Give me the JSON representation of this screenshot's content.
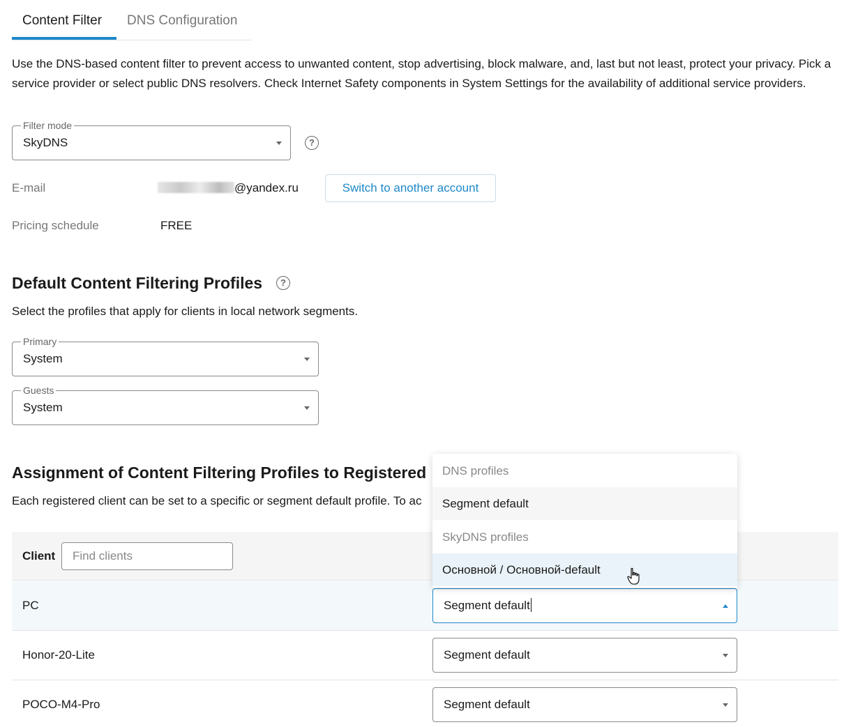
{
  "tabs": [
    {
      "label": "Content Filter",
      "active": true
    },
    {
      "label": "DNS Configuration",
      "active": false
    }
  ],
  "intro_text": "Use the DNS-based content filter to prevent access to unwanted content, stop advertising, block malware, and, last but not least, protect your privacy. Pick a service provider or select public DNS resolvers. Check Internet Safety components in System Settings for the availability of additional service providers.",
  "filter_mode": {
    "legend": "Filter mode",
    "value": "SkyDNS"
  },
  "email": {
    "label": "E-mail",
    "value": "@yandex.ru"
  },
  "switch_account_label": "Switch to another account",
  "pricing": {
    "label": "Pricing schedule",
    "value": "FREE"
  },
  "default_profiles": {
    "title": "Default Content Filtering Profiles",
    "description": "Select the profiles that apply for clients in local network segments.",
    "primary": {
      "legend": "Primary",
      "value": "System"
    },
    "guests": {
      "legend": "Guests",
      "value": "System"
    }
  },
  "assignment": {
    "title": "Assignment of Content Filtering Profiles to Registered",
    "description": "Each registered client can be set to a specific or segment default profile. To ac",
    "client_header": "Client",
    "search_placeholder": "Find clients"
  },
  "clients": [
    {
      "name": "PC",
      "profile": "Segment default"
    },
    {
      "name": "Honor-20-Lite",
      "profile": "Segment default"
    },
    {
      "name": "POCO-M4-Pro",
      "profile": "Segment default"
    }
  ],
  "dropdown": {
    "items": [
      {
        "label": "DNS profiles",
        "type": "group"
      },
      {
        "label": "Segment default",
        "type": "option"
      },
      {
        "label": "SkyDNS profiles",
        "type": "group"
      },
      {
        "label": "Основной / Основной-default",
        "type": "option"
      }
    ]
  },
  "icons": {
    "help": "question-circle-icon",
    "dropdown_arrow": "triangle-down-icon",
    "cursor": "hand-pointer-icon"
  },
  "colors": {
    "accent": "#1e88c7",
    "row_highlight": "#f3f8fb",
    "hover_option": "#eaf3f9"
  }
}
